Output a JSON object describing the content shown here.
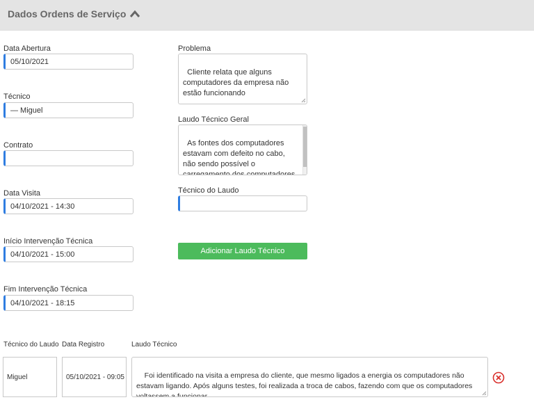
{
  "section": {
    "title": "Dados Ordens de Serviço"
  },
  "left_fields": [
    {
      "label": "Data Abertura",
      "value": "05/10/2021"
    },
    {
      "label": "Técnico",
      "value": "— Miguel"
    },
    {
      "label": "Contrato",
      "value": ""
    },
    {
      "label": "Data Visita",
      "value": "04/10/2021 - 14:30"
    },
    {
      "label": "Início Intervenção Técnica",
      "value": "04/10/2021 - 15:00"
    },
    {
      "label": "Fim Intervenção Técnica",
      "value": "04/10/2021 - 18:15"
    }
  ],
  "problema": {
    "label": "Problema",
    "value": "Cliente relata que alguns computadores da empresa não estão funcionando"
  },
  "laudo_geral": {
    "label": "Laudo Técnico Geral",
    "value": "As fontes dos computadores estavam com defeito no cabo, não sendo possível o carregamento dos computadores. Não ligavam pois não estavam carregando."
  },
  "tecnico_laudo": {
    "label": "Técnico do Laudo",
    "value": ""
  },
  "add_button": {
    "label": "Adicionar Laudo Técnico"
  },
  "laudos_table": {
    "headers": [
      "Técnico do Laudo",
      "Data Registro",
      "Laudo Técnico"
    ],
    "rows": [
      {
        "tecnico": "Miguel",
        "data": "05/10/2021 - 09:05",
        "laudo": "Foi identificado na visita a empresa do cliente, que mesmo ligados a energia os computadores não estavam ligando. Após alguns testes, foi realizada a troca de cabos, fazendo com que os computadores voltassem a funcionar."
      }
    ]
  },
  "colors": {
    "accent": "#2f7de1",
    "button": "#4cbb5c",
    "remove": "#d9302c",
    "header_bg": "#e4e4e4"
  },
  "icons": {
    "collapse": "chevron-up-icon",
    "remove": "remove-circle-icon"
  }
}
